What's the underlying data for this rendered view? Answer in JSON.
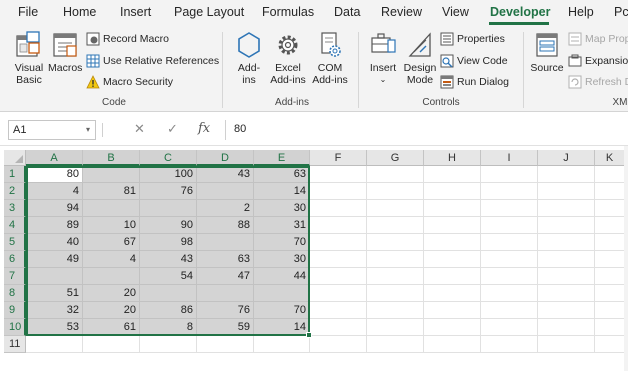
{
  "tabs": [
    "File",
    "Home",
    "Insert",
    "Page Layout",
    "Formulas",
    "Data",
    "Review",
    "View",
    "Developer",
    "Help",
    "Pc"
  ],
  "active_tab": "Developer",
  "ribbon": {
    "code": {
      "visual_basic": [
        "Visual",
        "Basic"
      ],
      "macros": "Macros",
      "record_macro": "Record Macro",
      "use_relative": "Use Relative References",
      "macro_security": "Macro Security",
      "label": "Code"
    },
    "addins": {
      "addins": [
        "Add-",
        "ins"
      ],
      "excel_addins": [
        "Excel",
        "Add-ins"
      ],
      "com_addins": [
        "COM",
        "Add-ins"
      ],
      "label": "Add-ins"
    },
    "controls": {
      "insert": "Insert",
      "design_mode": [
        "Design",
        "Mode"
      ],
      "properties": "Properties",
      "view_code": "View Code",
      "run_dialog": "Run Dialog",
      "label": "Controls"
    },
    "xml": {
      "source": "Source",
      "map_properties": "Map Prop",
      "expansion": "Expansio",
      "refresh_data": "Refresh D",
      "label": "XM"
    }
  },
  "formula_bar": {
    "name_box": "A1",
    "cancel_icon": "✕",
    "enter_icon": "✓",
    "fx": "fx",
    "value": "80"
  },
  "grid": {
    "columns": [
      "A",
      "B",
      "C",
      "D",
      "E",
      "F",
      "G",
      "H",
      "I",
      "J",
      "K"
    ],
    "rows": [
      "1",
      "2",
      "3",
      "4",
      "5",
      "6",
      "7",
      "8",
      "9",
      "10",
      "11"
    ],
    "cells": [
      [
        "80",
        "",
        "100",
        "43",
        "63"
      ],
      [
        "4",
        "81",
        "76",
        "",
        "14"
      ],
      [
        "94",
        "",
        "",
        "2",
        "30"
      ],
      [
        "89",
        "10",
        "90",
        "88",
        "31"
      ],
      [
        "40",
        "67",
        "98",
        "",
        "70"
      ],
      [
        "49",
        "4",
        "43",
        "63",
        "30"
      ],
      [
        "",
        "",
        "54",
        "47",
        "44"
      ],
      [
        "51",
        "20",
        "",
        "",
        ""
      ],
      [
        "32",
        "20",
        "86",
        "76",
        "70"
      ],
      [
        "53",
        "61",
        "8",
        "59",
        "14"
      ],
      [
        "",
        "",
        "",
        "",
        ""
      ]
    ]
  },
  "colors": {
    "accent": "#217346",
    "selection": "#d4d4d4",
    "ribbon_bg": "#f3f3f3"
  }
}
